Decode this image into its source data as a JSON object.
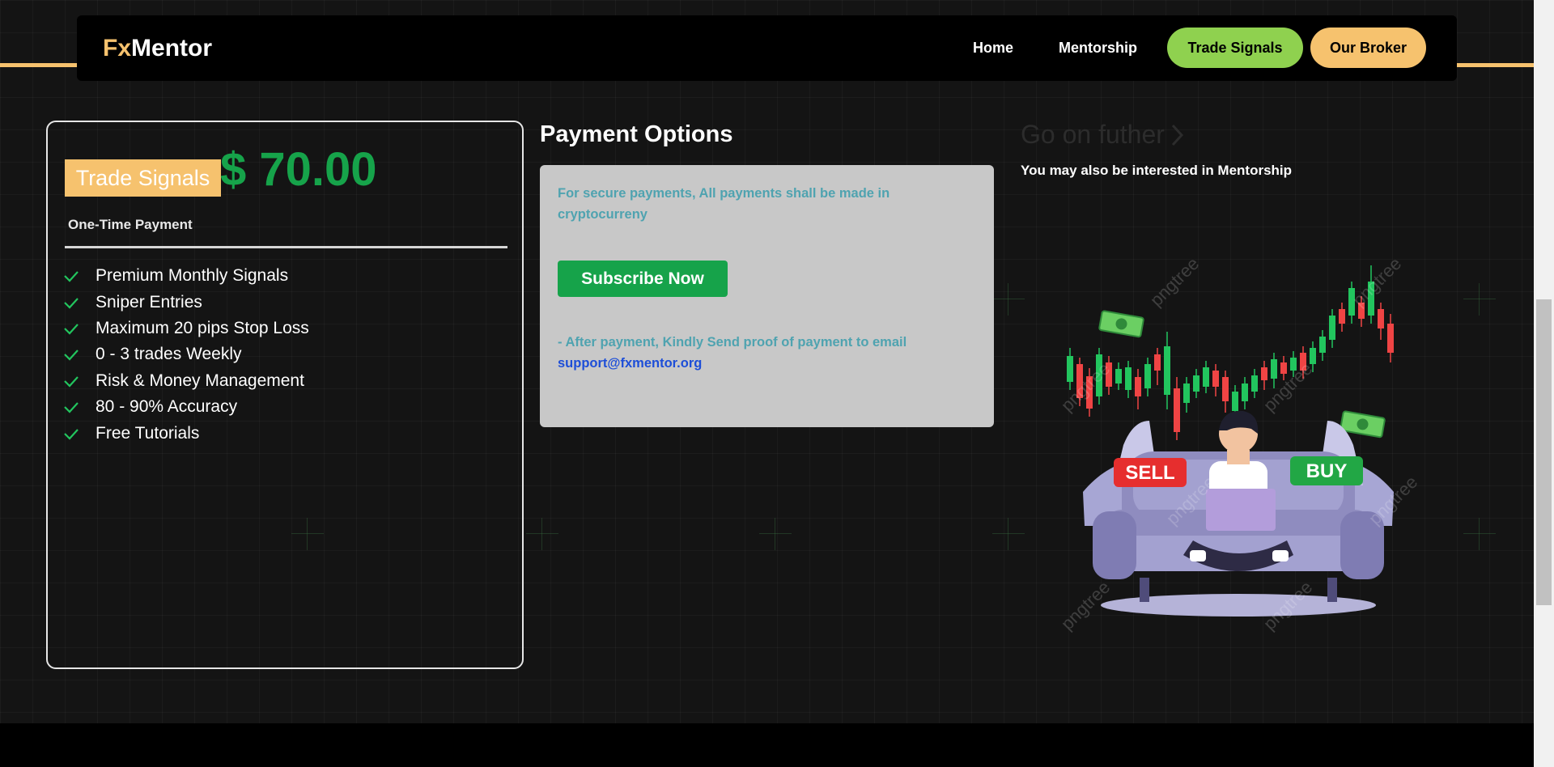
{
  "nav": {
    "logo_prefix": "Fx",
    "logo_suffix": "Mentor",
    "links": [
      "Home",
      "Mentorship"
    ],
    "trade_signals": "Trade Signals",
    "our_broker": "Our Broker"
  },
  "plan": {
    "name": "Trade Signals",
    "price": "$ 70.00",
    "payment_type": "One-Time Payment",
    "features": [
      "Premium Monthly Signals",
      "Sniper Entries",
      "Maximum 20 pips Stop Loss",
      "0 - 3 trades Weekly",
      "Risk & Money Management",
      "80 - 90% Accuracy",
      "Free Tutorials"
    ]
  },
  "payment": {
    "title": "Payment Options",
    "note": "For secure payments, All payments shall be made in cryptocurreny",
    "subscribe": "Subscribe Now",
    "after_note": "- After payment, Kindly Send proof of payment to email",
    "email": "support@fxmentor.org"
  },
  "further": {
    "title": "Go on futher",
    "subtitle": "You may also be interested in Mentorship"
  },
  "illustration": {
    "sell": "SELL",
    "buy": "BUY",
    "watermark": "pngtree"
  },
  "colors": {
    "accent_gold": "#f6c26e",
    "accent_green": "#16a34a",
    "signals_pill": "#8fd14f",
    "check_green": "#22c55e"
  },
  "icons": {
    "check": "check-icon",
    "chevron": "chevron-right-icon"
  }
}
